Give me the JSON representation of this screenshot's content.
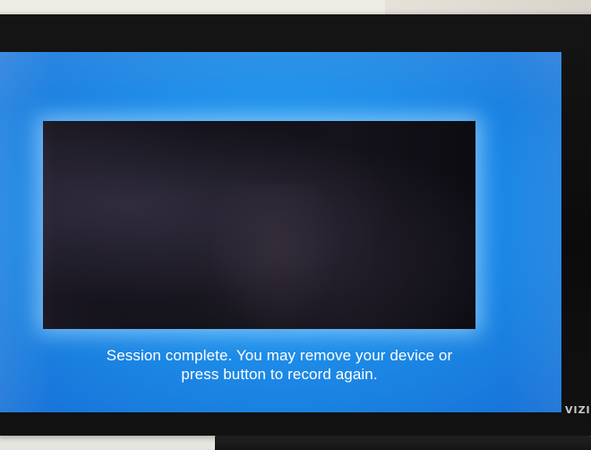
{
  "screen": {
    "message_line1": "Session complete. You may remove your device or",
    "message_line2": "press button to record again.",
    "brand_label": "VIZIO"
  },
  "colors": {
    "screen_blue": "#1e8fea",
    "panel_dark": "#14121a",
    "text": "#ffffff"
  }
}
